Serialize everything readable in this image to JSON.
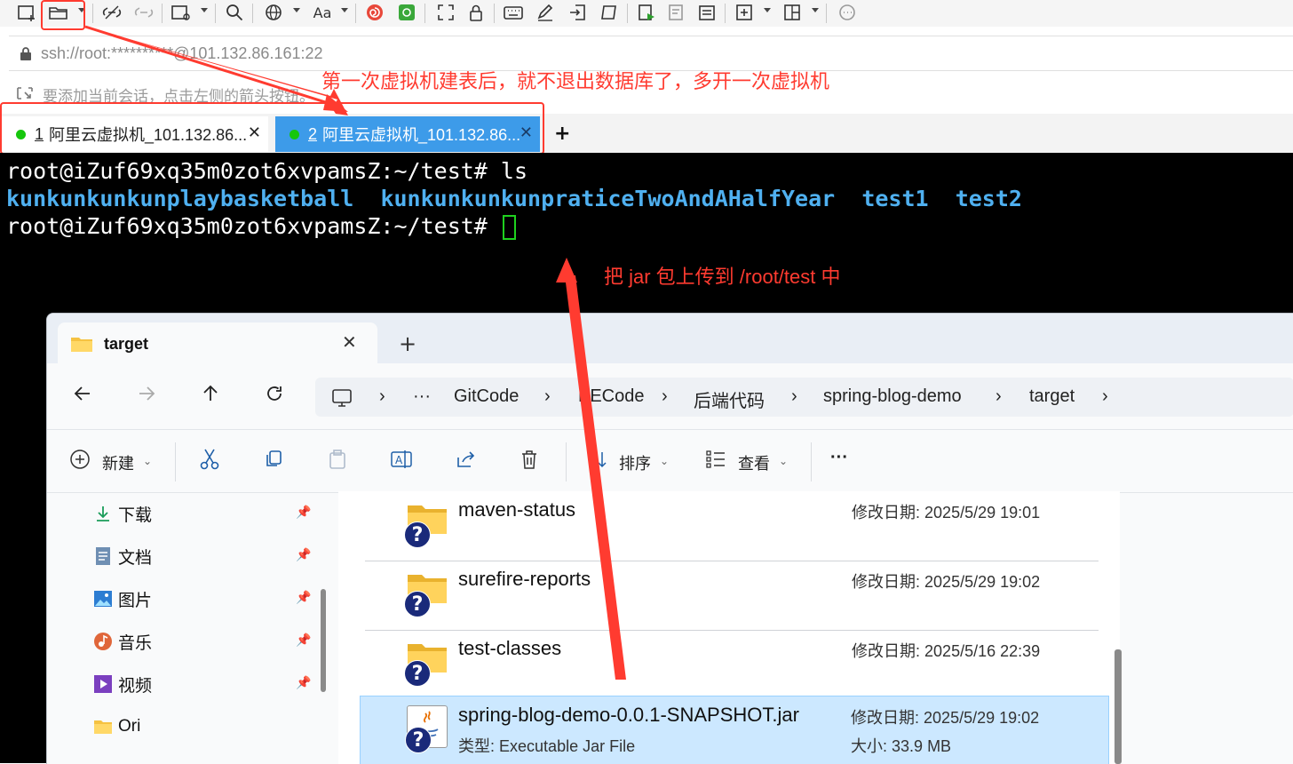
{
  "address": {
    "url": "ssh://root:**********@101.132.86.161:22"
  },
  "hint": {
    "text": "要添加当前会话，点击左侧的箭头按钮。"
  },
  "tabs": [
    {
      "number": "1",
      "label": "阿里云虚拟机_101.132.86...",
      "status_color": "#16c60c"
    },
    {
      "number": "2",
      "label": "阿里云虚拟机_101.132.86...",
      "status_color": "#16c60c"
    }
  ],
  "tab_add": "+",
  "terminal": {
    "prompt1": "root@iZuf69xq35m0zot6xvpamsZ:~/test# ls",
    "dirs": [
      "kunkunkunkunplaybasketball",
      "kunkunkunkunpraticeTwoAndAHalfYear",
      "test1",
      "test2"
    ],
    "prompt2": "root@iZuf69xq35m0zot6xvpamsZ:~/test# "
  },
  "annotations": {
    "note1": "第一次虚拟机建表后，就不退出数据库了，多开一次虚拟机",
    "note2": "把 jar 包上传到 /root/test 中",
    "color": "#ff3b30"
  },
  "explorer": {
    "tab_title": "target",
    "new_tab": "+",
    "breadcrumb": [
      "···",
      "GitCode",
      "EECode",
      "后端代码",
      "spring-blog-demo",
      "target"
    ],
    "commands": {
      "new": "新建",
      "sort": "排序",
      "view": "查看",
      "more": "···"
    },
    "sidebar": [
      {
        "label": "下载",
        "icon": "download-icon"
      },
      {
        "label": "文档",
        "icon": "document-icon"
      },
      {
        "label": "图片",
        "icon": "pictures-icon"
      },
      {
        "label": "音乐",
        "icon": "music-icon"
      },
      {
        "label": "视频",
        "icon": "video-icon"
      },
      {
        "label": "Ori",
        "icon": "folder-icon"
      }
    ],
    "files": [
      {
        "name": "maven-status",
        "modified_label": "修改日期:",
        "modified": "2025/5/29 19:01"
      },
      {
        "name": "surefire-reports",
        "modified_label": "修改日期:",
        "modified": "2025/5/29 19:02"
      },
      {
        "name": "test-classes",
        "modified_label": "修改日期:",
        "modified": "2025/5/16 22:39"
      },
      {
        "name": "spring-blog-demo-0.0.1-SNAPSHOT.jar",
        "modified_label": "修改日期:",
        "modified": "2025/5/29 19:02",
        "type_label": "类型:",
        "type": "Executable Jar File",
        "size_label": "大小:",
        "size": "33.9 MB",
        "selected": true
      }
    ]
  }
}
